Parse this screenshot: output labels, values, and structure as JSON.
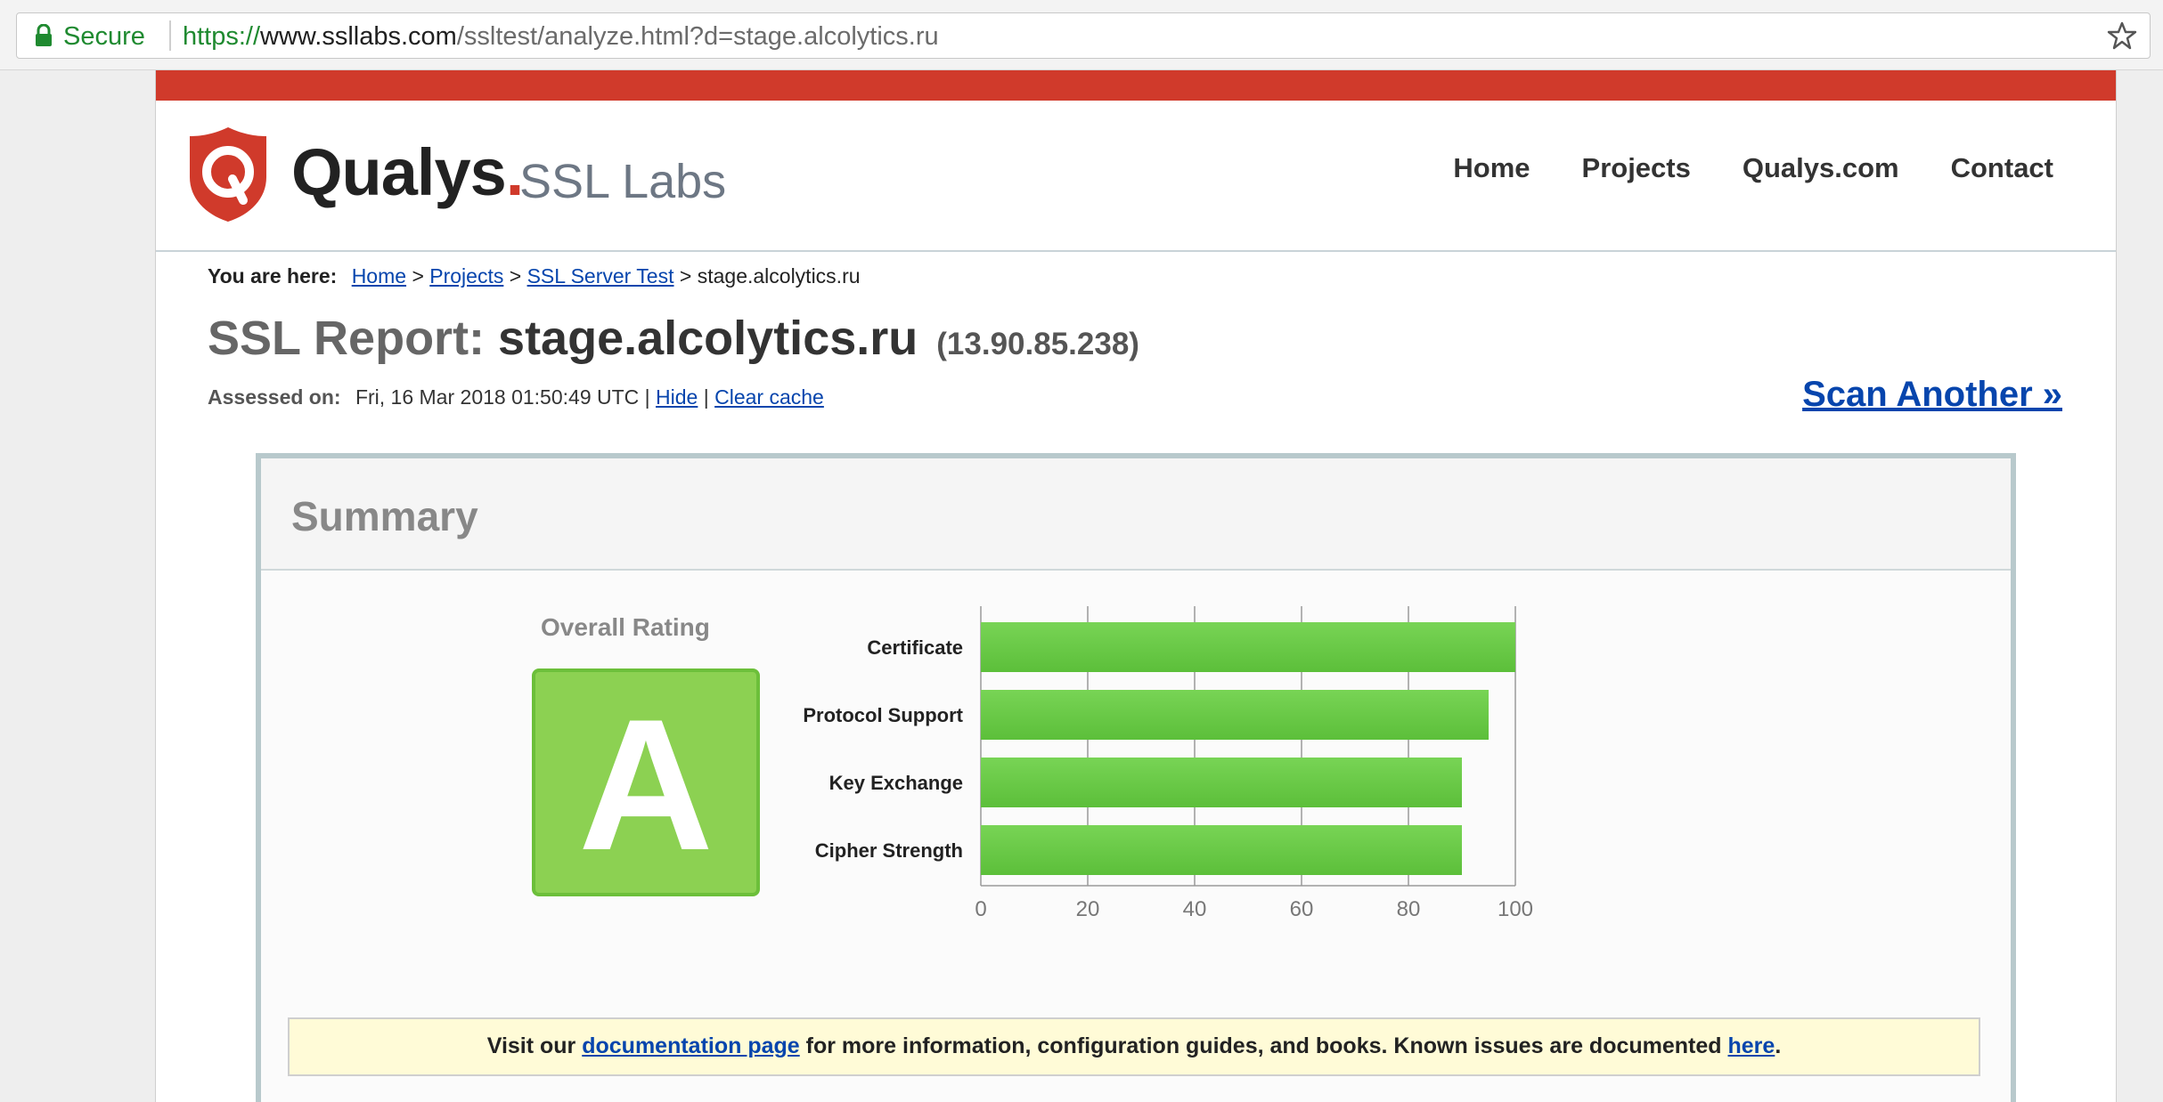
{
  "browser": {
    "secure_label": "Secure",
    "url_scheme": "https://",
    "url_host": "www.ssllabs.com",
    "url_rest": "/ssltest/analyze.html?d=stage.alcolytics.ru"
  },
  "header": {
    "logo_qualys": "Qualys",
    "logo_dot": ".",
    "logo_ssllabs": "SSL Labs",
    "nav": [
      "Home",
      "Projects",
      "Qualys.com",
      "Contact"
    ]
  },
  "breadcrumb": {
    "label": "You are here:",
    "items": [
      "Home",
      "Projects",
      "SSL Server Test"
    ],
    "separator": ">",
    "current": "stage.alcolytics.ru"
  },
  "report": {
    "title_prefix": "SSL Report:",
    "host": "stage.alcolytics.ru",
    "ip": "(13.90.85.238)",
    "assessed_label": "Assessed on:",
    "assessed_value": "Fri, 16 Mar 2018 01:50:49 UTC",
    "pipe": "|",
    "hide_link": "Hide",
    "clear_cache_link": "Clear cache",
    "scan_another": "Scan Another »"
  },
  "summary": {
    "title": "Summary",
    "overall_label": "Overall Rating",
    "grade": "A",
    "grade_color": "#8cd152",
    "bar_color": "#5cbf3a"
  },
  "chart_data": {
    "type": "bar",
    "orientation": "horizontal",
    "categories": [
      "Certificate",
      "Protocol Support",
      "Key Exchange",
      "Cipher Strength"
    ],
    "values": [
      100,
      95,
      90,
      90
    ],
    "xlim": [
      0,
      100
    ],
    "xticks": [
      0,
      20,
      40,
      60,
      80,
      100
    ],
    "grid": true
  },
  "notice": {
    "pre": "Visit our",
    "doc_link": "documentation page",
    "mid": "for more information, configuration guides, and books. Known issues are documented",
    "here_link": "here",
    "post": "."
  }
}
